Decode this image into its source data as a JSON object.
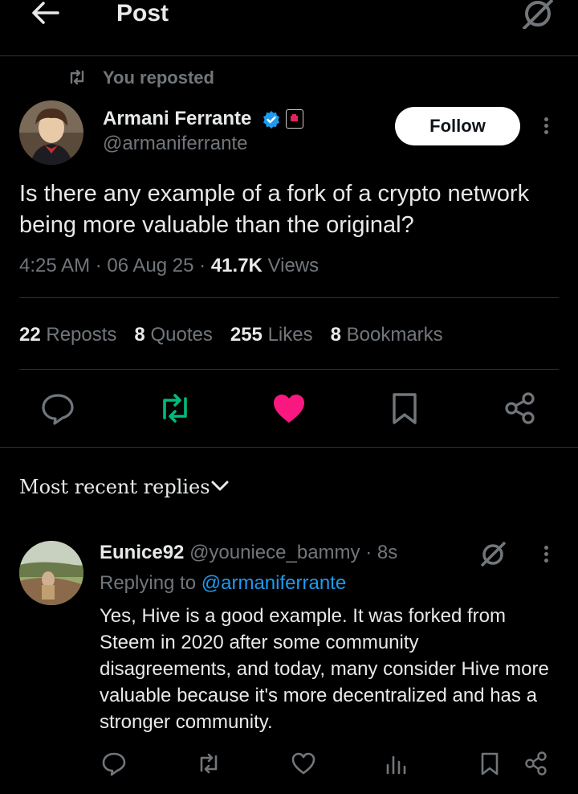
{
  "header": {
    "title": "Post"
  },
  "repost": {
    "label": "You reposted"
  },
  "author": {
    "name": "Armani Ferrante",
    "handle": "@armaniferrante",
    "follow_label": "Follow"
  },
  "post": {
    "text": "Is there any example of a fork of a crypto network being more valuable than the original?",
    "time": "4:25 AM",
    "date": "06 Aug 25",
    "views_count": "41.7K",
    "views_label": "Views"
  },
  "stats": {
    "reposts_count": "22",
    "reposts_label": "Reposts",
    "quotes_count": "8",
    "quotes_label": "Quotes",
    "likes_count": "255",
    "likes_label": "Likes",
    "bookmarks_count": "8",
    "bookmarks_label": "Bookmarks"
  },
  "replies_header": {
    "label": "Most recent replies"
  },
  "reply": {
    "name": "Eunice92",
    "handle": "@youniece_bammy",
    "time": "8s",
    "replying_prefix": "Replying to",
    "replying_to": "@armaniferrante",
    "text": "Yes, Hive is a good example. It was forked from Steem in 2020 after some community disagreements, and today, many consider Hive more valuable because it's more decentralized and has a stronger community."
  },
  "colors": {
    "accent": "#1d9bf0",
    "like": "#f91880",
    "repost": "#00ba7c",
    "muted": "#71767b"
  },
  "icons": [
    "back-arrow-icon",
    "grok-icon",
    "repost-icon",
    "verified-icon",
    "affiliate-badge-icon",
    "more-icon",
    "reply-icon",
    "like-icon",
    "bookmark-icon",
    "share-icon",
    "chevron-down-icon",
    "views-icon"
  ]
}
